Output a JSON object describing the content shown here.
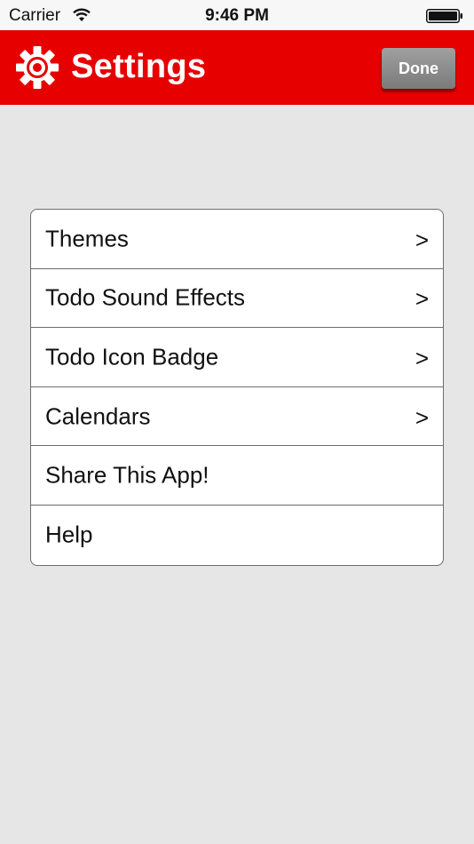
{
  "status_bar": {
    "carrier": "Carrier",
    "time": "9:46 PM",
    "wifi_icon": "wifi-icon",
    "battery_icon": "battery-icon"
  },
  "header": {
    "title": "Settings",
    "icon": "gear-icon",
    "done_label": "Done",
    "background_color": "#e60000"
  },
  "settings": {
    "items": [
      {
        "label": "Themes",
        "arrow": ">"
      },
      {
        "label": "Todo Sound Effects",
        "arrow": ">"
      },
      {
        "label": "Todo Icon Badge",
        "arrow": ">"
      },
      {
        "label": "Calendars",
        "arrow": ">"
      },
      {
        "label": "Share This App!",
        "arrow": ""
      },
      {
        "label": "Help",
        "arrow": ""
      }
    ]
  }
}
